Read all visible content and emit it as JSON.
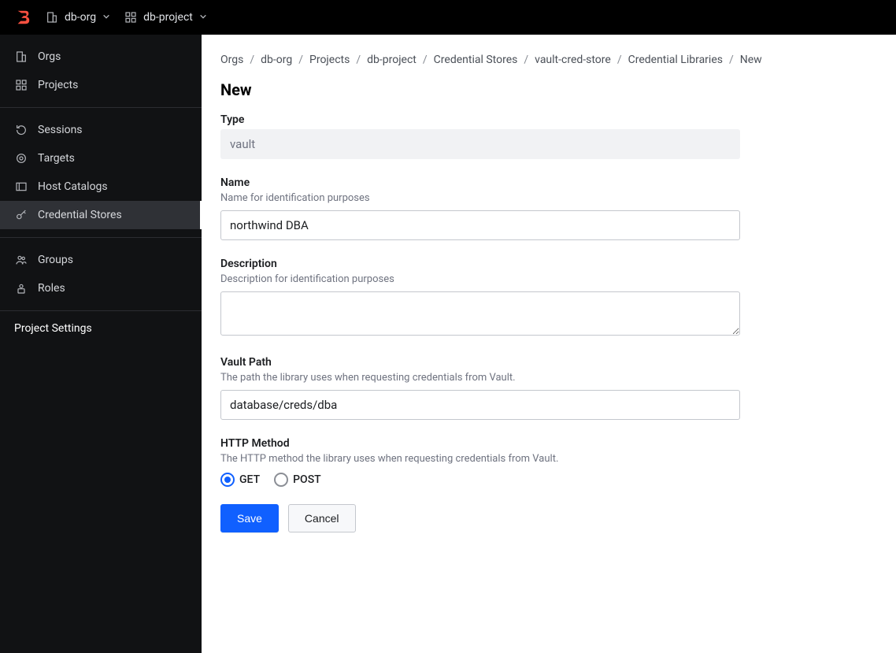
{
  "topbar": {
    "org_label": "db-org",
    "project_label": "db-project"
  },
  "sidebar": {
    "groups": [
      [
        {
          "label": "Orgs",
          "icon": "org",
          "active": false
        },
        {
          "label": "Projects",
          "icon": "project",
          "active": false
        }
      ],
      [
        {
          "label": "Sessions",
          "icon": "sessions",
          "active": false
        },
        {
          "label": "Targets",
          "icon": "targets",
          "active": false
        },
        {
          "label": "Host Catalogs",
          "icon": "hosts",
          "active": false
        },
        {
          "label": "Credential Stores",
          "icon": "key",
          "active": true
        }
      ],
      [
        {
          "label": "Groups",
          "icon": "groups",
          "active": false
        },
        {
          "label": "Roles",
          "icon": "roles",
          "active": false
        }
      ]
    ],
    "settings_label": "Project Settings"
  },
  "breadcrumbs": [
    {
      "label": "Orgs",
      "link": true
    },
    {
      "label": "db-org",
      "link": true
    },
    {
      "label": "Projects",
      "link": true
    },
    {
      "label": "db-project",
      "link": true
    },
    {
      "label": "Credential Stores",
      "link": true
    },
    {
      "label": "vault-cred-store",
      "link": true
    },
    {
      "label": "Credential Libraries",
      "link": true
    },
    {
      "label": "New",
      "link": false
    }
  ],
  "page_title": "New",
  "form": {
    "type": {
      "label": "Type",
      "value": "vault"
    },
    "name": {
      "label": "Name",
      "help": "Name for identification purposes",
      "value": "northwind DBA"
    },
    "description": {
      "label": "Description",
      "help": "Description for identification purposes",
      "value": ""
    },
    "vault_path": {
      "label": "Vault Path",
      "help": "The path the library uses when requesting credentials from Vault.",
      "value": "database/creds/dba"
    },
    "http_method": {
      "label": "HTTP Method",
      "help": "The HTTP method the library uses when requesting credentials from Vault.",
      "options": [
        {
          "label": "GET",
          "selected": true
        },
        {
          "label": "POST",
          "selected": false
        }
      ]
    },
    "save_label": "Save",
    "cancel_label": "Cancel"
  }
}
